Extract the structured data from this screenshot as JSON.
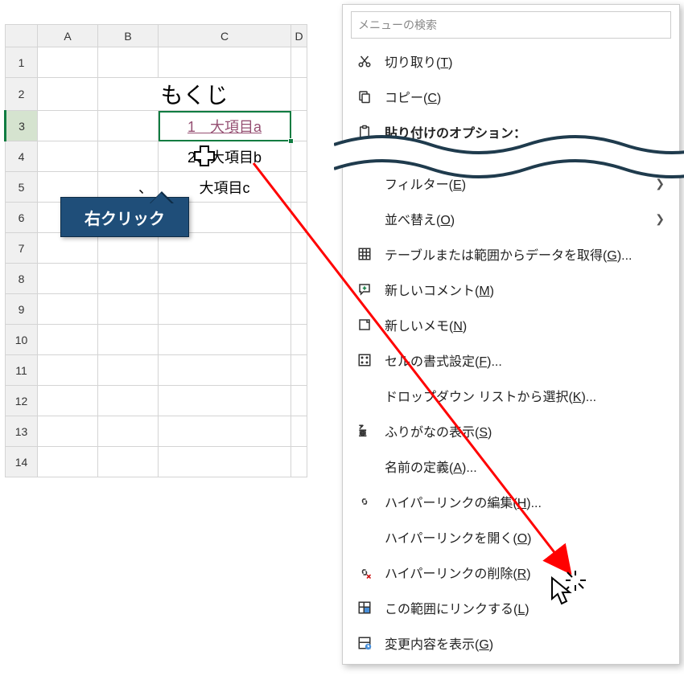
{
  "columns": {
    "A": "A",
    "B": "B",
    "C": "C",
    "D": "D"
  },
  "rows": {
    "1": "1",
    "2": "2",
    "3": "3",
    "4": "4",
    "5": "5",
    "6": "6",
    "7": "7",
    "8": "8",
    "9": "9",
    "10": "10",
    "11": "11",
    "12": "12",
    "13": "13",
    "14": "14"
  },
  "cells": {
    "title": "もくじ",
    "link1_prefix": "1",
    "link1_rest": "大項目a",
    "row4": "2、大項目b",
    "row5_prefix": "、",
    "row5": "大項目c"
  },
  "callout": {
    "label": "右クリック"
  },
  "menu": {
    "search_placeholder": "メニューの検索",
    "cut": "切り取り(<u>T</u>)",
    "copy": "コピー(<u>C</u>)",
    "paste_options": "貼り付けのオプション：",
    "filter": "フィルター(<u>E</u>)",
    "sort": "並べ替え(<u>O</u>)",
    "table_data": "テーブルまたは範囲からデータを取得(<u>G</u>)...",
    "new_comment": "新しいコメント(<u>M</u>)",
    "new_note": "新しいメモ(<u>N</u>)",
    "format_cells": "セルの書式設定(<u>F</u>)...",
    "dropdown_select": "ドロップダウン リストから選択(<u>K</u>)...",
    "furigana": "ふりがなの表示(<u>S</u>)",
    "define_name": "名前の定義(<u>A</u>)...",
    "edit_hyperlink": "ハイパーリンクの編集(<u>H</u>)...",
    "open_hyperlink": "ハイパーリンクを開く(<u>O</u>)",
    "remove_hyperlink": "ハイパーリンクの削除(<u>R</u>)",
    "link_range": "この範囲にリンクする(<u>L</u>)",
    "show_changes": "変更内容を表示(<u>G</u>)"
  }
}
